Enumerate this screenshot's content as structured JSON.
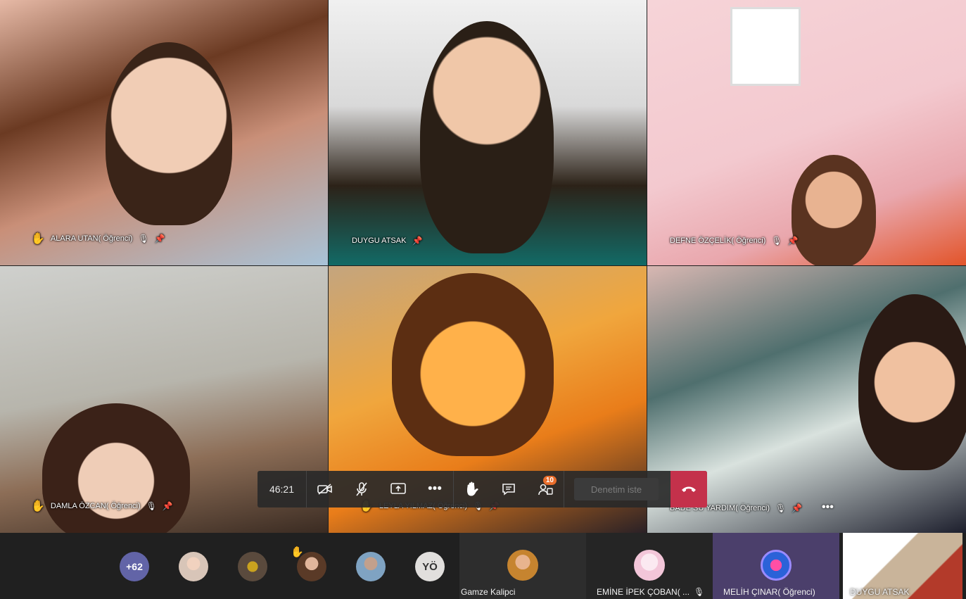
{
  "video_tiles": [
    {
      "name": "ALARA UTAN( Öğrenci)",
      "hand_raised": true,
      "muted": true
    },
    {
      "name": "DUYGU ATSAK",
      "hand_raised": false,
      "muted": false
    },
    {
      "name": "DEFNE ÖZÇELİK( Öğrenci)",
      "hand_raised": false,
      "muted": true
    },
    {
      "name": "DAMLA ÖZCAN( Öğrenci)",
      "hand_raised": true,
      "muted": true
    },
    {
      "name": "LEYLA YILMAZ( Öğrenci)",
      "hand_raised": true,
      "muted": true
    },
    {
      "name": "BADE SU YARDIM( Öğrenci)",
      "hand_raised": false,
      "muted": true
    }
  ],
  "controls": {
    "timer": "46:21",
    "chat_badge": "10",
    "request_label": "Denetim iste",
    "more_options": "•••",
    "tile_more": "•••"
  },
  "strip": {
    "more_count": "+62",
    "initials": "YÖ",
    "participants": [
      {
        "name": "Gamze Kalipci"
      },
      {
        "name": "EMİNE İPEK ÇOBAN( ..."
      },
      {
        "name": "MELİH ÇINAR( Öğrenci)"
      },
      {
        "name": "DUYGU ATSAK"
      }
    ]
  },
  "icons": {
    "hand": "✋",
    "mic_off": "🎙",
    "pin": "📌"
  },
  "colors": {
    "hangup": "#c4314b",
    "badge": "#e96d2b",
    "accent": "#6264a7"
  }
}
